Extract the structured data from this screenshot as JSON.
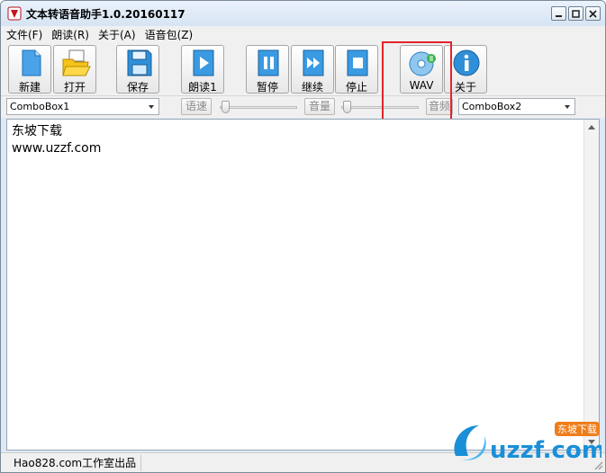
{
  "window": {
    "title": "文本转语音助手1.0.20160117"
  },
  "menu": [
    {
      "label": "文件(F)"
    },
    {
      "label": "朗读(R)"
    },
    {
      "label": "关于(A)"
    },
    {
      "label": "语音包(Z)"
    }
  ],
  "toolbar": {
    "new": "新建",
    "open": "打开",
    "save": "保存",
    "read": "朗读1",
    "pause": "暂停",
    "resume": "继续",
    "stop": "停止",
    "wav": "WAV",
    "about": "关于"
  },
  "controls": {
    "combo1": "ComboBox1",
    "speed_label": "语速",
    "volume_label": "音量",
    "pitch_label": "音频",
    "combo2": "ComboBox2"
  },
  "editor": {
    "content": "东坡下载\nwww.uzzf.com"
  },
  "status": {
    "text": "Hao828.com工作室出品"
  },
  "watermark": {
    "brand": "uzzf.com",
    "badge": "东坡下载"
  },
  "colors": {
    "highlight": "#e3242b",
    "icon_blue": "#2f8fd8"
  }
}
